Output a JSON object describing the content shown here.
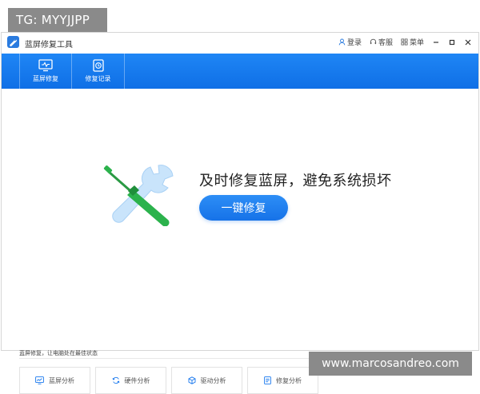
{
  "watermarks": {
    "top": "TG: MYYJJPP",
    "bottom": "www.marcosandreo.com"
  },
  "titlebar": {
    "title": "蓝屏修复工具",
    "login": "登录",
    "support": "客服",
    "menu": "菜单"
  },
  "nav": {
    "items": [
      {
        "label": "蓝屏修复",
        "icon": "monitor-icon"
      },
      {
        "label": "修复记录",
        "icon": "history-icon"
      }
    ]
  },
  "hero": {
    "headline": "及时修复蓝屏，避免系统损坏",
    "button": "一键修复"
  },
  "footer": {
    "label": "蓝屏修复，让电脑处在最佳状态",
    "cards": [
      {
        "label": "蓝屏分析",
        "icon": "chart-icon"
      },
      {
        "label": "硬件分析",
        "icon": "sync-icon"
      },
      {
        "label": "驱动分析",
        "icon": "cube-icon"
      },
      {
        "label": "修复分析",
        "icon": "document-icon"
      }
    ]
  },
  "colors": {
    "accent": "#1777ee",
    "green": "#2bb24c",
    "wrench": "#bfe0fb"
  }
}
